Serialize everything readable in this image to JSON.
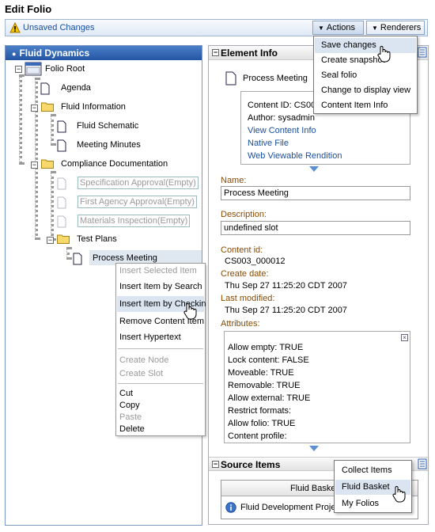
{
  "page": {
    "title": "Edit Folio"
  },
  "toolbar": {
    "unsaved_label": "Unsaved Changes",
    "actions_label": "Actions",
    "renderers_label": "Renderers"
  },
  "actions_menu": {
    "items": [
      "Save changes",
      "Create snapshot",
      "Seal folio",
      "Change to display view",
      "Content Item Info"
    ]
  },
  "tree": {
    "header": "Fluid Dynamics",
    "root": "Folio Root",
    "agenda": "Agenda",
    "fluid_info": "Fluid Information",
    "fluid_schematic": "Fluid Schematic",
    "meeting_minutes": "Meeting Minutes",
    "compliance": "Compliance Documentation",
    "spec_approval": "Specification Approval(Empty)",
    "first_agency": "First Agency Approval(Empty)",
    "materials": "Materials Inspection(Empty)",
    "test_plans": "Test Plans",
    "process_meeting": "Process Meeting"
  },
  "context_menu": {
    "insert_selected": "Insert Selected Item",
    "insert_search": "Insert Item by Search",
    "insert_checkin": "Insert Item by Checkin",
    "remove_content": "Remove Content Item",
    "insert_hypertext": "Insert Hypertext",
    "create_node": "Create Node",
    "create_slot": "Create Slot",
    "cut": "Cut",
    "copy": "Copy",
    "paste": "Paste",
    "delete": "Delete"
  },
  "element_info": {
    "header": "Element Info",
    "item_title": "Process Meeting",
    "content_id_line": "Content ID: CS00",
    "author_line": "Author: sysadmin",
    "view_content_info": "View Content Info",
    "native_file": "Native File",
    "web_viewable": "Web Viewable Rendition",
    "name_label": "Name:",
    "name_value": "Process Meeting",
    "description_label": "Description:",
    "description_value": "undefined slot",
    "content_id_label": "Content id:",
    "content_id_value": "CS003_000012",
    "create_date_label": "Create date:",
    "create_date_value": "Thu Sep 27 11:25:20 CDT 2007",
    "last_modified_label": "Last modified:",
    "last_modified_value": "Thu Sep 27 11:25:20 CDT 2007",
    "attributes_label": "Attributes:",
    "attributes": [
      "Allow empty: TRUE",
      "Lock content: FALSE",
      "Moveable: TRUE",
      "Removable: TRUE",
      "Allow external: TRUE",
      "Restrict formats:",
      "Allow folio: TRUE",
      "Content profile:"
    ]
  },
  "source_items": {
    "header": "Source Items",
    "column_header": "Fluid Baske",
    "row_text": "Fluid Development Proje"
  },
  "renderers_menu": {
    "items": [
      "Collect Items",
      "Fluid Basket",
      "My Folios"
    ]
  }
}
